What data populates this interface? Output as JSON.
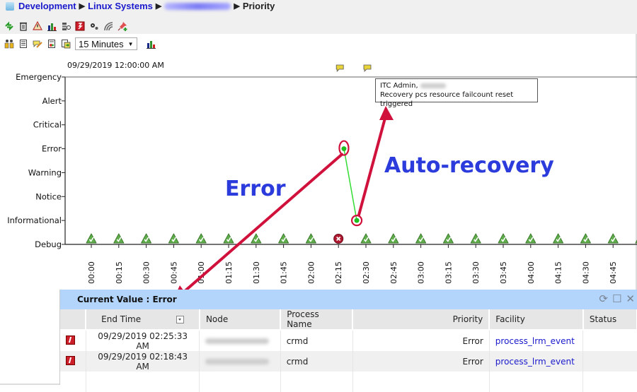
{
  "breadcrumb": {
    "items": [
      "Development",
      "Linux Systems"
    ],
    "hidden_item": "[redacted host]",
    "current": "Priority",
    "separator": "▶"
  },
  "toolbar_row1": {
    "icons": [
      "refresh-icon",
      "trash-icon",
      "alert-config-icon",
      "bar-chart-icon",
      "filter-icon",
      "event-flag-icon",
      "settings-gears-icon",
      "signal-icon",
      "pin-add-icon"
    ]
  },
  "toolbar_row2": {
    "icons": [
      "group-icon",
      "document-icon",
      "edit-note-icon",
      "report-icon",
      "export-icon"
    ],
    "time_range": {
      "selected": "15 Minutes"
    },
    "chart-icon": "bar-chart-icon"
  },
  "chart_data": {
    "type": "scatter",
    "title": "09/29/2019 12:00:00 AM",
    "xlabel": "",
    "ylabel": "",
    "y_categories": [
      "Debug",
      "Informational",
      "Notice",
      "Warning",
      "Error",
      "Critical",
      "Alert",
      "Emergency"
    ],
    "x_ticks": [
      "00:00",
      "00:15",
      "00:30",
      "00:45",
      "01:00",
      "01:15",
      "01:30",
      "01:45",
      "02:00",
      "02:15",
      "02:30",
      "02:45",
      "03:00",
      "03:15",
      "03:30",
      "03:45",
      "04:00",
      "04:15",
      "04:30",
      "04:45"
    ],
    "status_markers": [
      "ok",
      "ok",
      "ok",
      "ok",
      "ok",
      "ok",
      "ok",
      "ok",
      "ok",
      "error",
      "ok",
      "ok",
      "ok",
      "ok",
      "ok",
      "ok",
      "ok",
      "ok",
      "ok",
      "ok"
    ],
    "series": [
      {
        "name": "Priority",
        "points": [
          {
            "x": "02:18",
            "y": "Error"
          },
          {
            "x": "02:25",
            "y": "Informational"
          }
        ],
        "color": "#33dd33"
      }
    ],
    "annotation_markers_x": [
      "02:15",
      "02:30"
    ],
    "grid": false
  },
  "tooltip": {
    "line1_prefix": "ITC Admin,",
    "line2": "Recovery pcs resource failcount reset triggered"
  },
  "callouts": {
    "error_label": "Error",
    "recovery_label": "Auto-recovery",
    "label_color": "#2b3bdc",
    "arrow_color": "#d0113c"
  },
  "panel": {
    "title": "Current Value : Error",
    "columns": [
      "",
      "End Time",
      "Node",
      "Process Name",
      "Priority",
      "Facility",
      "Status"
    ],
    "rows": [
      {
        "end_time": "09/29/2019 02:25:33 AM",
        "node": "[redacted]",
        "process": "crmd",
        "priority": "Error",
        "facility": "process_lrm_event",
        "status": ""
      },
      {
        "end_time": "09/29/2019 02:18:43 AM",
        "node": "[redacted]",
        "process": "crmd",
        "priority": "Error",
        "facility": "process_lrm_event",
        "status": ""
      }
    ]
  }
}
